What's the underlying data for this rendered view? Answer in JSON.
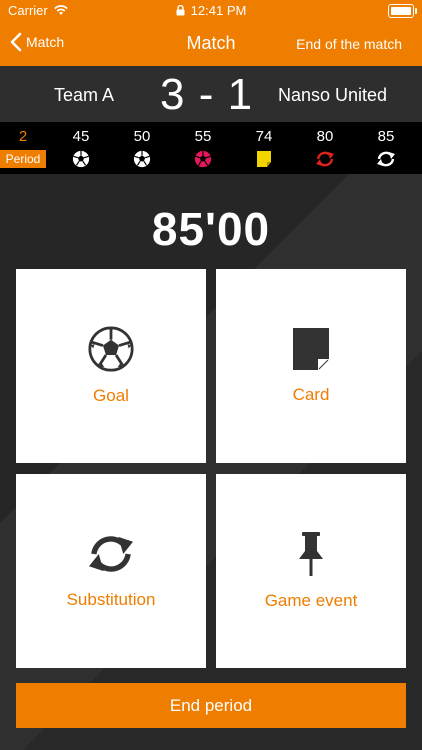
{
  "status_bar": {
    "carrier": "Carrier",
    "time": "12:41 PM"
  },
  "nav": {
    "back_label": "Match",
    "title": "Match",
    "right_action": "End of the match"
  },
  "scoreboard": {
    "team_a": "Team A",
    "score": "3 - 1",
    "team_b": "Nanso United"
  },
  "timeline": {
    "period_number": "2",
    "period_label": "Period",
    "events": [
      {
        "minute": "45",
        "icon": "football-icon",
        "color": "#ffffff"
      },
      {
        "minute": "50",
        "icon": "football-icon",
        "color": "#ffffff"
      },
      {
        "minute": "55",
        "icon": "football-icon",
        "color": "#e8175d"
      },
      {
        "minute": "74",
        "icon": "yellow-card-icon",
        "color": "#f2d400"
      },
      {
        "minute": "80",
        "icon": "substitution-icon",
        "color": "#e0211f"
      },
      {
        "minute": "85",
        "icon": "substitution-icon",
        "color": "#ffffff"
      }
    ]
  },
  "match_clock": "85'00",
  "actions": {
    "goal": "Goal",
    "card": "Card",
    "substitution": "Substitution",
    "game_event": "Game event"
  },
  "end_period_label": "End period",
  "colors": {
    "accent": "#ef7d00",
    "background": "#2a2a2b"
  }
}
